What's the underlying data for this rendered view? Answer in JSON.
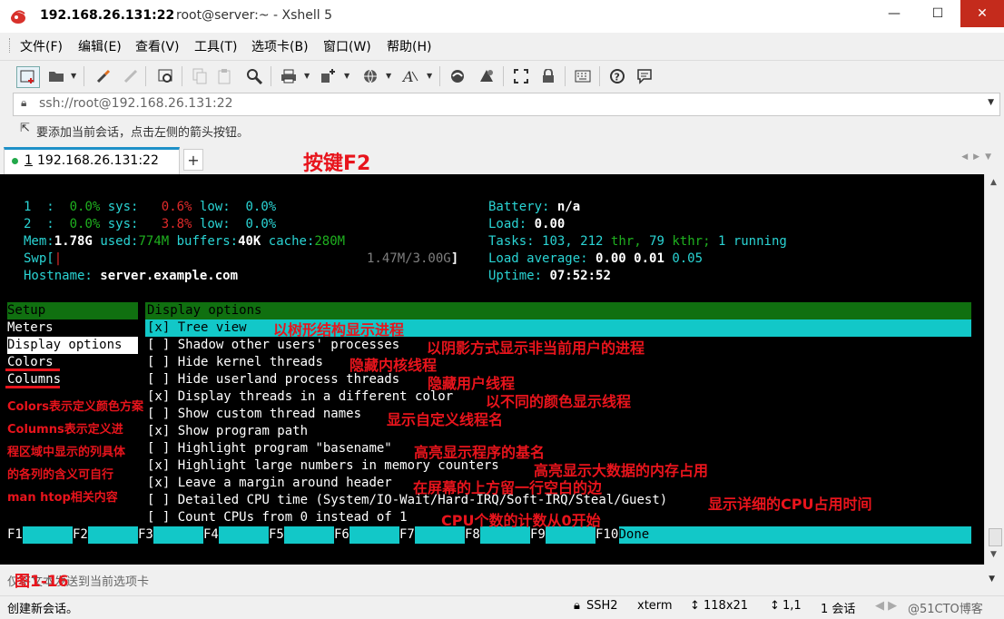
{
  "window": {
    "title_ip": "192.168.26.131:22",
    "title_rest": "root@server:~ - Xshell 5",
    "minimize": "—",
    "maximize": "☐",
    "close": "✕"
  },
  "menu": [
    "文件(F)",
    "编辑(E)",
    "查看(V)",
    "工具(T)",
    "选项卡(B)",
    "窗口(W)",
    "帮助(H)"
  ],
  "address": {
    "value": "ssh://root@192.168.26.131:22"
  },
  "hint": {
    "text": "要添加当前会话，点击左侧的箭头按钮。"
  },
  "tabs": [
    {
      "num": "1",
      "label": "192.168.26.131:22"
    }
  ],
  "tab_add": "+",
  "annotations": {
    "f2": "按键F2",
    "tree": "以树形结构显示进程",
    "shadow": "以阴影方式显示非当前用户的进程",
    "kernel": "隐藏内核线程",
    "userland": "隐藏用户线程",
    "color": "以不同的颜色显示线程",
    "custom": "显示自定义线程名",
    "basename": "高亮显示程序的基名",
    "large": "高亮显示大数据的内存占用",
    "margin": "在屏幕的上方留一行空白的边",
    "cputime": "显示详细的CPU占用时间",
    "count": "CPU个数的计数从0开始",
    "left": [
      "Colors表示定义颜色方案",
      "Columns表示定义进",
      "程区域中显示的列具体",
      "的各列的含义可自行",
      "man htop相关内容"
    ],
    "figure": "图1-16"
  },
  "terminal": {
    "cpu1": {
      "id": "1",
      "usr": "0.0%",
      "sys_label": "sys:",
      "sys": "0.6%",
      "low_label": "low:",
      "low": "0.0%"
    },
    "cpu2": {
      "id": "2",
      "usr": "0.0%",
      "sys_label": "sys:",
      "sys": "3.8%",
      "low_label": "low:",
      "low": "0.0%"
    },
    "mem": {
      "label": "Mem:",
      "total": "1.78G",
      "used_label": "used:",
      "used": "774M",
      "buffers_label": "buffers:",
      "buffers": "40K",
      "cache_label": "cache:",
      "cache": "280M"
    },
    "swp": {
      "label": "Swp[",
      "value": "1.47M/3.00G",
      "close": "]"
    },
    "hostname": {
      "label": "Hostname:",
      "value": "server.example.com"
    },
    "battery": {
      "label": "Battery:",
      "value": "n/a"
    },
    "load": {
      "label": "Load:",
      "value": "0.00"
    },
    "tasks": {
      "label": "Tasks:",
      "tasks": "103,",
      "thr_count": "212",
      "thr_label": "thr,",
      "kthr_count": "79",
      "kthr_label": "kthr;",
      "running": "1",
      "running_label": "running"
    },
    "loadavg": {
      "label": "Load average:",
      "v1": "0.00",
      "v2": "0.01",
      "v3": "0.05"
    },
    "uptime": {
      "label": "Uptime:",
      "value": "07:52:52"
    },
    "setup": {
      "header": "Setup",
      "items": [
        "Meters",
        "Display options",
        "Colors",
        "Columns"
      ],
      "panel_header": "Display options",
      "options": [
        {
          "mark": "[x]",
          "label": "Tree view"
        },
        {
          "mark": "[ ]",
          "label": "Shadow other users' processes"
        },
        {
          "mark": "[ ]",
          "label": "Hide kernel threads"
        },
        {
          "mark": "[ ]",
          "label": "Hide userland process threads"
        },
        {
          "mark": "[x]",
          "label": "Display threads in a different color"
        },
        {
          "mark": "[ ]",
          "label": "Show custom thread names"
        },
        {
          "mark": "[x]",
          "label": "Show program path"
        },
        {
          "mark": "[ ]",
          "label": "Highlight program \"basename\""
        },
        {
          "mark": "[x]",
          "label": "Highlight large numbers in memory counters"
        },
        {
          "mark": "[x]",
          "label": "Leave a margin around header"
        },
        {
          "mark": "[ ]",
          "label": "Detailed CPU time (System/IO-Wait/Hard-IRQ/Soft-IRQ/Steal/Guest)"
        },
        {
          "mark": "[ ]",
          "label": "Count CPUs from 0 instead of 1"
        }
      ]
    },
    "fkeys": [
      "F1",
      "F2",
      "F3",
      "F4",
      "F5",
      "F6",
      "F7",
      "F8",
      "F9",
      "F10"
    ],
    "f10_label": "Done"
  },
  "compose": {
    "placeholder": "仅将文本发送到当前选项卡"
  },
  "status": {
    "left": "创建新会话。",
    "proto": "SSH2",
    "term": "xterm",
    "size": "118x21",
    "pos": "1,1",
    "sessions": "1 会话",
    "watermark": "@51CTO博客"
  },
  "colors": {
    "accent": "#1e90c8",
    "cyan": "#2ad4d4",
    "green_bar": "#107010",
    "annotation": "#e8141c"
  }
}
